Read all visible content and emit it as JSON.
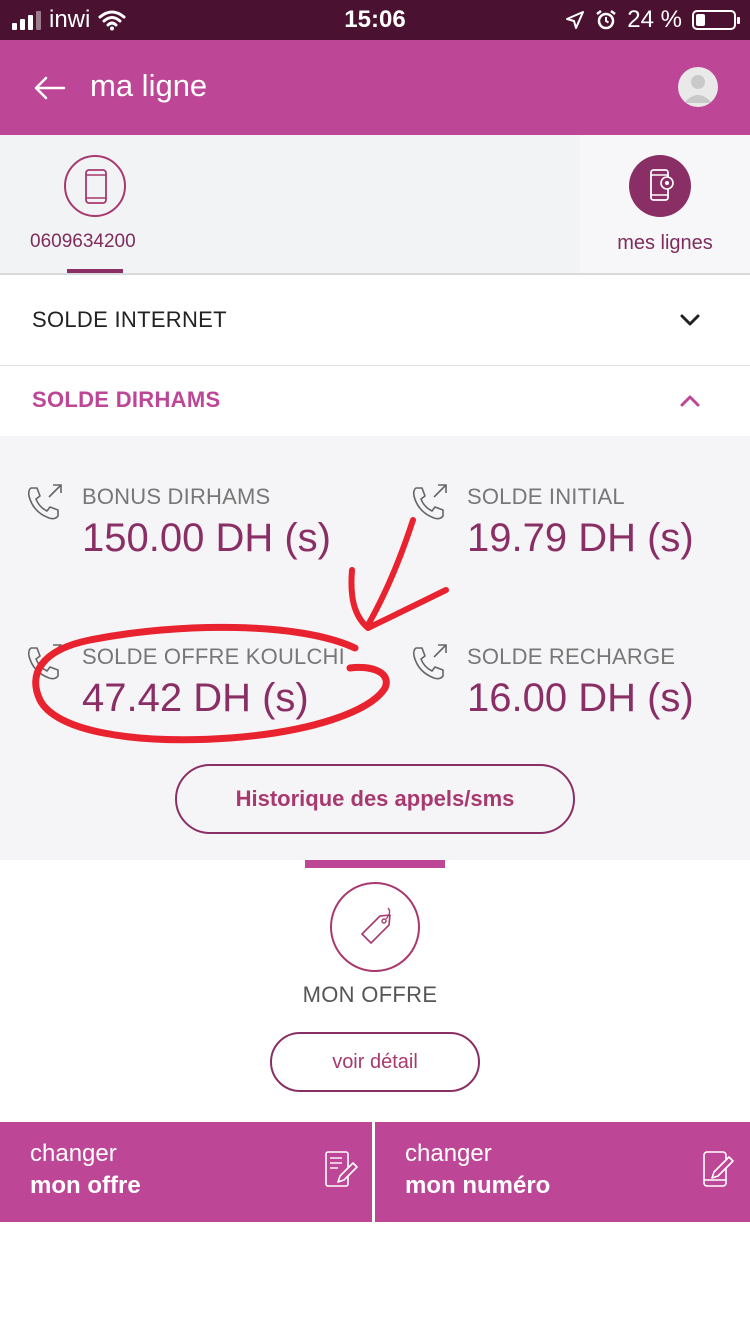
{
  "status_bar": {
    "carrier": "inwi",
    "time": "15:06",
    "battery": "24 %",
    "battery_level": 0.24
  },
  "app_bar": {
    "title": "ma ligne"
  },
  "lines": {
    "phone_number": "0609634200",
    "manage_label": "mes lignes"
  },
  "accordions": {
    "internet_label": "SOLDE INTERNET",
    "dirhams_label": "SOLDE DIRHAMS"
  },
  "balances": [
    {
      "label": "BONUS DIRHAMS",
      "value": "150.00 DH (s)"
    },
    {
      "label": "SOLDE INITIAL",
      "value": "19.79 DH (s)"
    },
    {
      "label": "SOLDE OFFRE KOULCHI",
      "value": "47.42 DH (s)"
    },
    {
      "label": "SOLDE RECHARGE",
      "value": "16.00 DH (s)"
    }
  ],
  "history_button": "Historique des appels/sms",
  "offer": {
    "title": "MON OFFRE",
    "detail_button": "voir détail"
  },
  "actions": {
    "change_offer": {
      "line1": "changer",
      "line2": "mon offre"
    },
    "change_number": {
      "line1": "changer",
      "line2": "mon numéro"
    }
  },
  "colors": {
    "brand_pink": "#bd4796",
    "brand_plum": "#8a2f65",
    "status_bar": "#4a1230",
    "annotation_red": "#e8232f"
  }
}
